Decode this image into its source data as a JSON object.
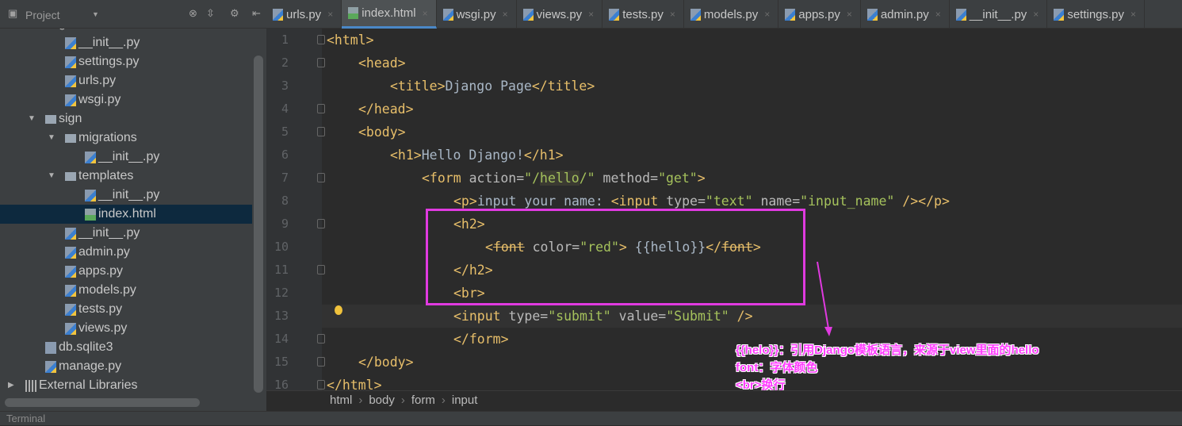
{
  "sidebar": {
    "title": "Project",
    "tree": [
      {
        "label": "guest",
        "level": 1,
        "type": "dir",
        "expanded": true
      },
      {
        "label": "__init__.py",
        "level": 2,
        "type": "py"
      },
      {
        "label": "settings.py",
        "level": 2,
        "type": "py"
      },
      {
        "label": "urls.py",
        "level": 2,
        "type": "py"
      },
      {
        "label": "wsgi.py",
        "level": 2,
        "type": "py"
      },
      {
        "label": "sign",
        "level": 1,
        "type": "dir",
        "expanded": true
      },
      {
        "label": "migrations",
        "level": 2,
        "type": "dir",
        "expanded": true
      },
      {
        "label": "__init__.py",
        "level": 3,
        "type": "py"
      },
      {
        "label": "templates",
        "level": 2,
        "type": "dir",
        "expanded": true
      },
      {
        "label": "__init__.py",
        "level": 3,
        "type": "py"
      },
      {
        "label": "index.html",
        "level": 3,
        "type": "htm",
        "selected": true
      },
      {
        "label": "__init__.py",
        "level": 2,
        "type": "py"
      },
      {
        "label": "admin.py",
        "level": 2,
        "type": "py"
      },
      {
        "label": "apps.py",
        "level": 2,
        "type": "py"
      },
      {
        "label": "models.py",
        "level": 2,
        "type": "py"
      },
      {
        "label": "tests.py",
        "level": 2,
        "type": "py"
      },
      {
        "label": "views.py",
        "level": 2,
        "type": "py"
      },
      {
        "label": "db.sqlite3",
        "level": 1,
        "type": "dbf"
      },
      {
        "label": "manage.py",
        "level": 1,
        "type": "py"
      },
      {
        "label": "External Libraries",
        "level": 0,
        "type": "lib",
        "expanded": false
      }
    ]
  },
  "tabs": [
    {
      "label": "urls.py",
      "type": "py"
    },
    {
      "label": "index.html",
      "type": "htm",
      "active": true
    },
    {
      "label": "wsgi.py",
      "type": "py"
    },
    {
      "label": "views.py",
      "type": "py"
    },
    {
      "label": "tests.py",
      "type": "py"
    },
    {
      "label": "models.py",
      "type": "py"
    },
    {
      "label": "apps.py",
      "type": "py"
    },
    {
      "label": "admin.py",
      "type": "py"
    },
    {
      "label": "__init__.py",
      "type": "py"
    },
    {
      "label": "settings.py",
      "type": "py"
    }
  ],
  "editor": {
    "current_line": 13,
    "lines": [
      {
        "n": "1",
        "indent": 0,
        "fold": true,
        "tokens": [
          [
            "tag",
            "<html>"
          ]
        ]
      },
      {
        "n": "2",
        "indent": 1,
        "fold": true,
        "tokens": [
          [
            "tag",
            "<head>"
          ]
        ]
      },
      {
        "n": "3",
        "indent": 2,
        "tokens": [
          [
            "tag",
            "<title>"
          ],
          [
            "text",
            "Django Page"
          ],
          [
            "tag",
            "</title>"
          ]
        ]
      },
      {
        "n": "4",
        "indent": 1,
        "fold": true,
        "tokens": [
          [
            "tag",
            "</head>"
          ]
        ]
      },
      {
        "n": "5",
        "indent": 1,
        "fold": true,
        "tokens": [
          [
            "tag",
            "<body>"
          ]
        ]
      },
      {
        "n": "6",
        "indent": 2,
        "tokens": [
          [
            "tag",
            "<h1>"
          ],
          [
            "text",
            "Hello Django!"
          ],
          [
            "tag",
            "</h1>"
          ]
        ]
      },
      {
        "n": "7",
        "indent": 3,
        "fold": true,
        "tokens": [
          [
            "tag",
            "<form "
          ],
          [
            "attr",
            "action="
          ],
          [
            "val",
            "\"/"
          ],
          [
            "ref",
            "hello"
          ],
          [
            "val",
            "/\""
          ],
          [
            "attr",
            " method="
          ],
          [
            "val",
            "\"get\""
          ],
          [
            "tag",
            ">"
          ]
        ]
      },
      {
        "n": "8",
        "indent": 4,
        "tokens": [
          [
            "tag",
            "<p>"
          ],
          [
            "text",
            "input your name: "
          ],
          [
            "tag",
            "<input"
          ],
          [
            "attr",
            " type="
          ],
          [
            "val",
            "\"text\""
          ],
          [
            "attr",
            " name="
          ],
          [
            "val",
            "\"input_name\""
          ],
          [
            "tag",
            " /></p>"
          ]
        ]
      },
      {
        "n": "9",
        "indent": 4,
        "fold": true,
        "tokens": [
          [
            "tag",
            "<h2>"
          ]
        ]
      },
      {
        "n": "10",
        "indent": 5,
        "tokens": [
          [
            "tag",
            "<"
          ],
          [
            "tag strike",
            "font"
          ],
          [
            "attr",
            " color="
          ],
          [
            "val",
            "\"red\""
          ],
          [
            "tag",
            ">"
          ],
          [
            "text",
            " {{hello}}"
          ],
          [
            "tag",
            "</"
          ],
          [
            "tag strike",
            "font"
          ],
          [
            "tag",
            ">"
          ]
        ]
      },
      {
        "n": "11",
        "indent": 4,
        "fold": true,
        "tokens": [
          [
            "tag",
            "</h2>"
          ]
        ]
      },
      {
        "n": "12",
        "indent": 4,
        "tokens": [
          [
            "tag",
            "<br>"
          ]
        ]
      },
      {
        "n": "13",
        "indent": 4,
        "tokens": [
          [
            "tag",
            "<input "
          ],
          [
            "attr",
            "type="
          ],
          [
            "val",
            "\"submit\""
          ],
          [
            "attr",
            " value="
          ],
          [
            "val",
            "\"Submit\""
          ],
          [
            "tag",
            " />"
          ]
        ]
      },
      {
        "n": "14",
        "indent": 4,
        "fold": true,
        "tokens": [
          [
            "tag",
            "</form>"
          ]
        ]
      },
      {
        "n": "15",
        "indent": 1,
        "fold": true,
        "tokens": [
          [
            "tag",
            "</body>"
          ]
        ]
      },
      {
        "n": "16",
        "indent": 0,
        "fold": true,
        "tokens": [
          [
            "tag",
            "</html>"
          ]
        ]
      }
    ]
  },
  "annotation": {
    "color": "#ff3cff",
    "lines": [
      "{{helo}}：引用Django模板语言，来源于view里面的hello",
      "font：字体颜色",
      "<br>换行"
    ]
  },
  "breadcrumb": [
    "html",
    "body",
    "form",
    "input"
  ],
  "bottom_bar": {
    "terminal_label": "Terminal"
  }
}
